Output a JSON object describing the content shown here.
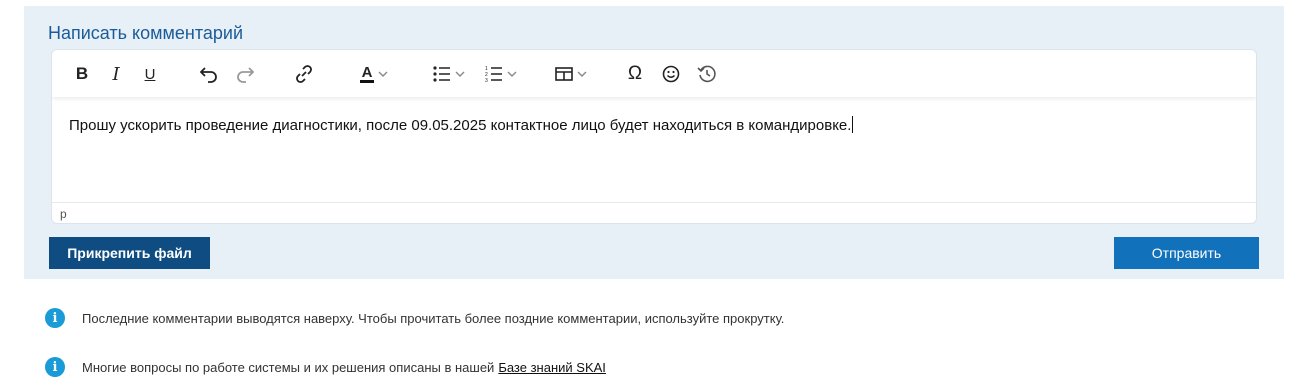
{
  "comment_form": {
    "title": "Написать комментарий",
    "content": "Прошу ускорить проведение диагностики, после 09.05.2025 контактное лицо будет находиться в командировке.",
    "status_path": "p",
    "attach_label": "Прикрепить файл",
    "send_label": "Отправить"
  },
  "toolbar": {
    "bold": "B",
    "italic": "I",
    "underline": "U",
    "special_char": "Ω",
    "font_color": "A"
  },
  "info": {
    "line1": "Последние комментарии выводятся наверху. Чтобы прочитать более поздние комментарии, используйте прокрутку.",
    "line2_prefix": "Многие вопросы по работе системы и их решения описаны в нашей",
    "line2_link": "Базе знаний SKAI"
  }
}
